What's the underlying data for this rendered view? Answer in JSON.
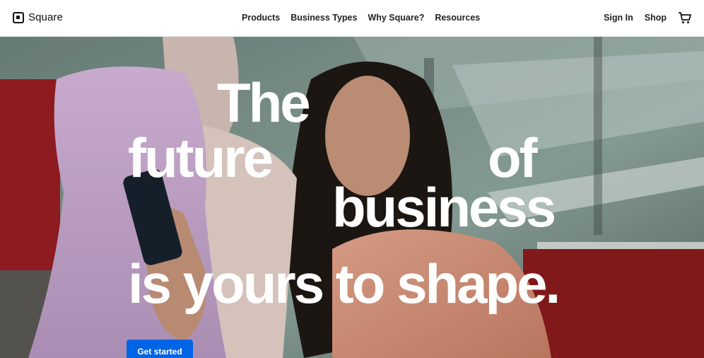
{
  "brand": {
    "name": "Square"
  },
  "nav": {
    "items": [
      "Products",
      "Business Types",
      "Why Square?",
      "Resources"
    ],
    "sign_in": "Sign In",
    "shop": "Shop"
  },
  "hero": {
    "line1": "The",
    "line2a": "future",
    "line2b": "of",
    "line3": "business",
    "line4": "is yours to shape.",
    "cta_label": "Get started"
  },
  "colors": {
    "cta": "#0064e6",
    "header_bg": "#ffffff",
    "text": "#222222"
  },
  "icons": [
    "square-logo-icon",
    "cart-icon"
  ]
}
